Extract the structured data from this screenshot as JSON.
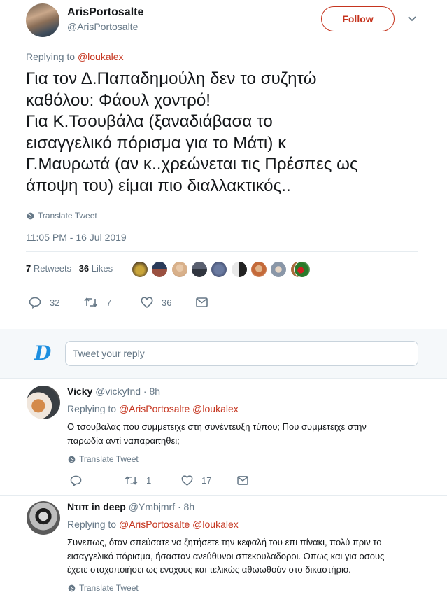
{
  "main_tweet": {
    "author_name": "ArisPortosalte",
    "author_handle": "@ArisPortosalte",
    "follow_label": "Follow",
    "replying_label": "Replying to",
    "replying_to": "@loukalex",
    "text_lines": [
      "Για τον Δ.Παπαδημούλη δεν το συζητώ",
      "καθόλου: Φάουλ χοντρό!",
      "Για Κ.Τσουβάλα (ξαναδιάβασα το",
      "εισαγγελικό πόρισμα για το Μάτι) κ",
      "Γ.Μαυρωτά (αν κ..χρεώνεται τις Πρέσπες ως",
      "άποψη του) είμαι πιο διαλλακτικός.."
    ],
    "translate_label": "Translate Tweet",
    "timestamp": "11:05 PM - 16 Jul 2019",
    "retweets_count": "7",
    "retweets_label": "Retweets",
    "likes_count": "36",
    "likes_label": "Likes",
    "reply_count": "32",
    "retweet_count": "7",
    "like_count": "36"
  },
  "reply_box": {
    "placeholder": "Tweet your reply",
    "logo_letter": "D"
  },
  "replies": [
    {
      "name": "Vicky",
      "handle": "@vickyfnd",
      "time": "· 8h",
      "replying_label": "Replying to",
      "replying_to": "@ArisPortosalte @loukalex",
      "text_lines": [
        "Ο τσουβαλας που συμμετειχε στη συνέντευξη τύπου; Που συμμετειχε στην",
        "παρωδία αντί ναπαραιτηθει;"
      ],
      "translate_label": "Translate Tweet",
      "reply_count": "",
      "retweet_count": "1",
      "like_count": "17"
    },
    {
      "name": "Ντιπ in deep",
      "handle": "@Ymbjmrf",
      "time": "· 8h",
      "replying_label": "Replying to",
      "replying_to": "@ArisPortosalte @loukalex",
      "text_lines": [
        "Συνεπως, όταν σπεύσατε να ζητήσετε την κεφαλή του επι πίνακι, πολύ πριν το",
        "εισαγγελικό πόρισμα, ήσασταν ανεύθυνοι σπεκουλαδοροι. Οπως και για οσους",
        "έχετε στοχοποιήσει ως ενοχους και τελικώς αθωωθούν στο δικαστήριο."
      ],
      "translate_label": "Translate Tweet"
    }
  ],
  "colors": {
    "accent": "#c5341e",
    "muted": "#657786",
    "divider": "#e6ecf0",
    "reply_bg": "#f5f8fa"
  }
}
